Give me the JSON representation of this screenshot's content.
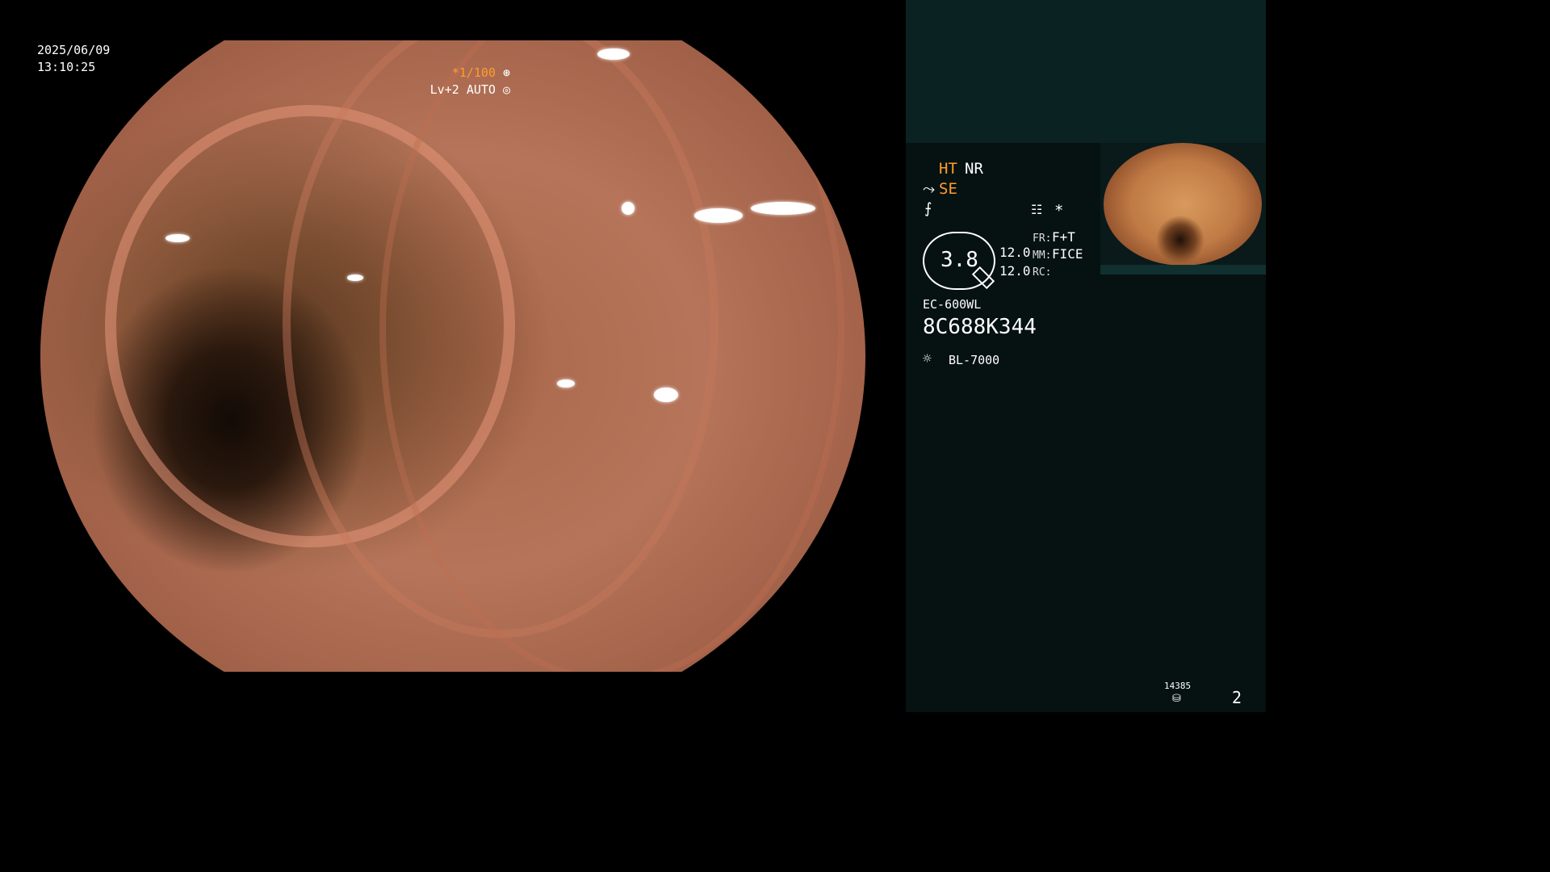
{
  "osd": {
    "date": "2025/06/09",
    "time": "13:10:25",
    "shutter": "*1/100",
    "level": "Lv+2",
    "exposure": "AUTO"
  },
  "panel": {
    "ht": "HT",
    "nr": "NR",
    "se": "SE",
    "star": "*",
    "gauge_value": "3.8",
    "val_1": "12.0",
    "val_2": "12.0",
    "fr_label": "FR:",
    "fr_value": "F+T",
    "mm_label": "MM:",
    "mm_value": "FICE",
    "rc_label": "RC:",
    "scope_model": "EC-600WL",
    "serial": "8C688K344",
    "light_source": "BL-7000",
    "counter": "14385",
    "page_number": "2"
  },
  "colors": {
    "panel_bg": "#061111",
    "panel_top_bg": "#0b2223",
    "accent": "#ff9d2e"
  }
}
